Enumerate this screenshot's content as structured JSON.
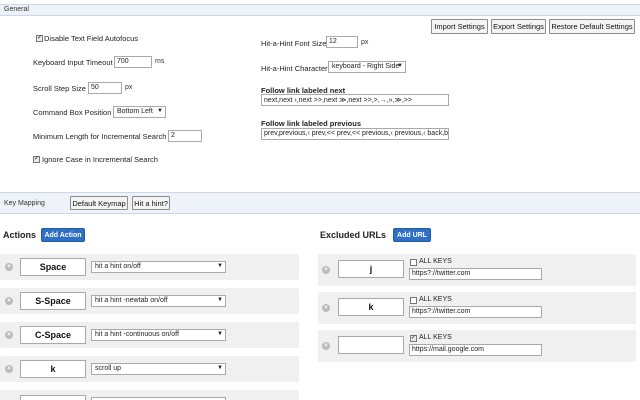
{
  "general": {
    "title": "General",
    "buttons": {
      "import": "Import Settings",
      "export": "Export Settings",
      "restore": "Restore Default Settings"
    },
    "disable_autofocus": {
      "label": "Disable Text Field Autofocus",
      "checked": true
    },
    "keyboard_timeout": {
      "label": "Keyboard Input Timeout",
      "value": "700",
      "unit": "ms"
    },
    "scroll_step": {
      "label": "Scroll Step Size",
      "value": "50",
      "unit": "px"
    },
    "command_box": {
      "label": "Command Box Position",
      "value": "Bottom Left"
    },
    "min_length": {
      "label": "Minimum Length for Incremental Search",
      "value": "2"
    },
    "ignore_case": {
      "label": "Ignore Case in Incremental Search",
      "checked": true
    },
    "hint_font_size": {
      "label": "Hit-a-Hint Font Size",
      "value": "12",
      "unit": "px"
    },
    "hint_character": {
      "label": "Hit-a-Hint Character",
      "value": "keyboard - Right Side"
    },
    "follow_next": {
      "label": "Follow link labeled next",
      "value": "next,next ›,next >>,next ≫,next >>,>,→,»,≫,>>"
    },
    "follow_prev": {
      "label": "Follow link labeled previous",
      "value": "prev,previous,‹ prev,<< prev,<< previous,‹ previous,‹ back,bac"
    }
  },
  "key_mapping": {
    "title": "Key Mapping",
    "default_keymap": "Default Keymap",
    "hit_a_hint": "Hit a hint?"
  },
  "actions": {
    "title": "Actions",
    "add_label": "Add Action",
    "rows": [
      {
        "key": "Space",
        "action": "hit a hint on/off"
      },
      {
        "key": "S-Space",
        "action": "hit a hint -newtab on/off"
      },
      {
        "key": "C-Space",
        "action": "hit a hint -continuous on/off"
      },
      {
        "key": "k",
        "action": "scroll up"
      }
    ]
  },
  "excluded": {
    "title": "Excluded URLs",
    "add_label": "Add URL",
    "all_keys_label": "ALL KEYS",
    "rows": [
      {
        "key": "j",
        "all_keys": false,
        "url": "https?://twitter.com"
      },
      {
        "key": "k",
        "all_keys": false,
        "url": "https?://twitter.com"
      },
      {
        "key": "",
        "all_keys": true,
        "url": "https://mail.google.com"
      }
    ]
  }
}
